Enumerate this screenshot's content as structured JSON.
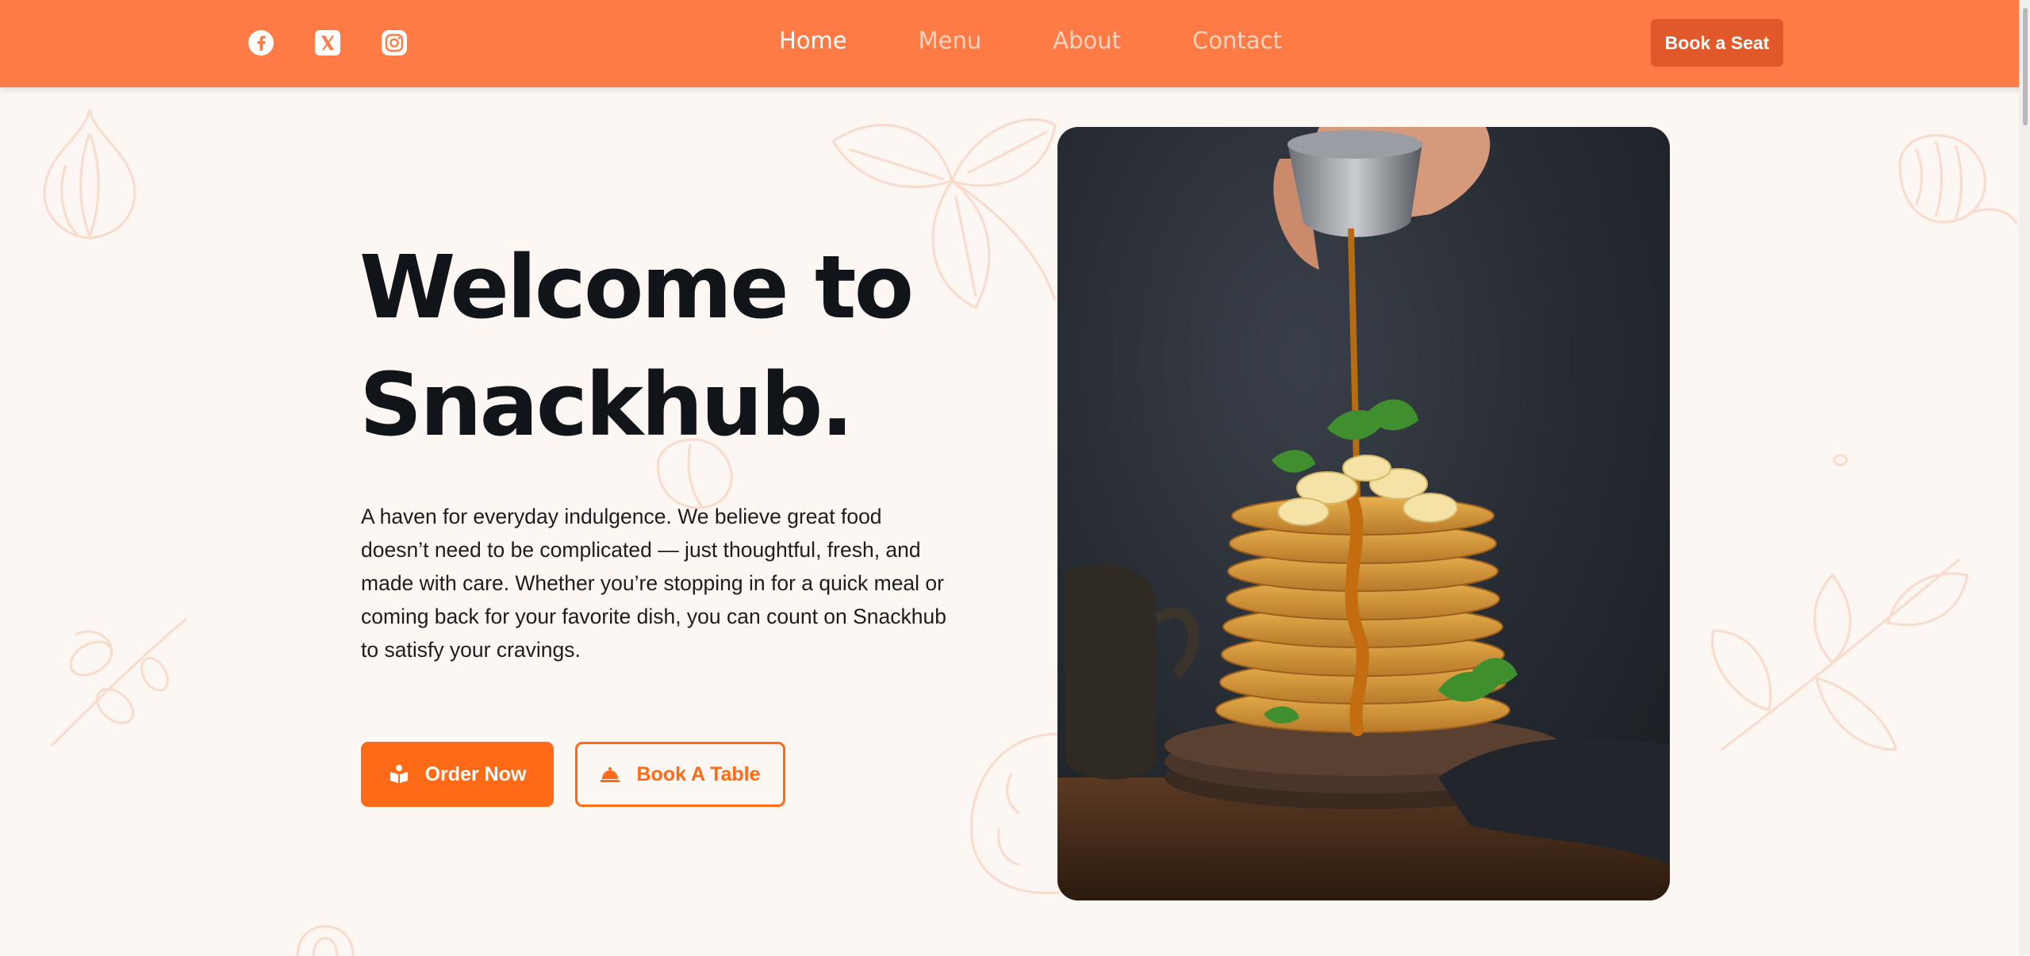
{
  "social": [
    {
      "name": "facebook-icon"
    },
    {
      "name": "x-twitter-icon"
    },
    {
      "name": "instagram-icon"
    }
  ],
  "nav": {
    "items": [
      {
        "label": "Home",
        "active": true
      },
      {
        "label": "Menu",
        "active": false
      },
      {
        "label": "About",
        "active": false
      },
      {
        "label": "Contact",
        "active": false
      }
    ],
    "cta_label": "Book a Seat"
  },
  "hero": {
    "title_line1": "Welcome to",
    "title_line2": "Snackhub.",
    "description": "A haven for everyday indulgence. We believe great food doesn’t need to be complicated — just thoughtful, fresh, and made with care. Whether you’re stopping in for a quick meal or coming back for your favorite dish, you can count on Snackhub to satisfy your cravings.",
    "order_button": {
      "label": "Order Now",
      "icon": "book-open-icon"
    },
    "table_button": {
      "label": "Book A Table",
      "icon": "cloche-icon"
    },
    "image_icon": "pancake-stack-syrup-photo"
  },
  "colors": {
    "nav_bg": "#ff7b45",
    "accent": "#ff6a16",
    "cta_bg": "#e1582a",
    "page_bg": "#fdf7f3",
    "heading": "#111418"
  }
}
